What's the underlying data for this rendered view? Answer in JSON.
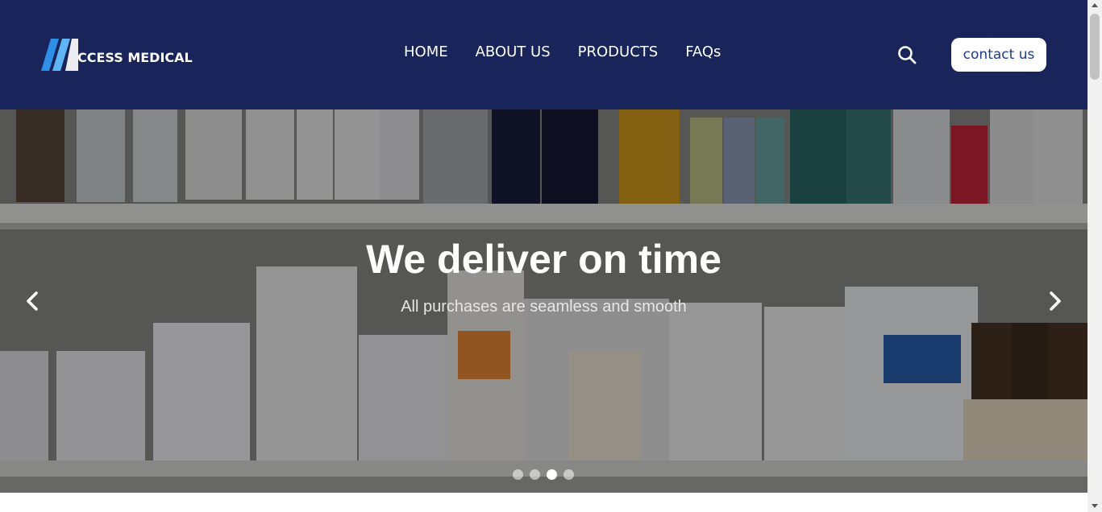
{
  "header": {
    "logo_text": "CCESS MEDICAL",
    "nav": [
      {
        "label": "HOME"
      },
      {
        "label": "ABOUT US"
      },
      {
        "label": "PRODUCTS"
      },
      {
        "label": "FAQs"
      }
    ],
    "search_icon": "search-icon",
    "contact_label": "contact us"
  },
  "hero": {
    "title": "We deliver on time",
    "subtitle": "All purchases are seamless and smooth",
    "prev_icon": "chevron-left-icon",
    "next_icon": "chevron-right-icon",
    "slides_count": 4,
    "active_slide": 3
  },
  "colors": {
    "header_bg": "#18245a",
    "logo_blue": "#2f8fe6",
    "button_text": "#1e3a8a",
    "white": "#ffffff"
  }
}
